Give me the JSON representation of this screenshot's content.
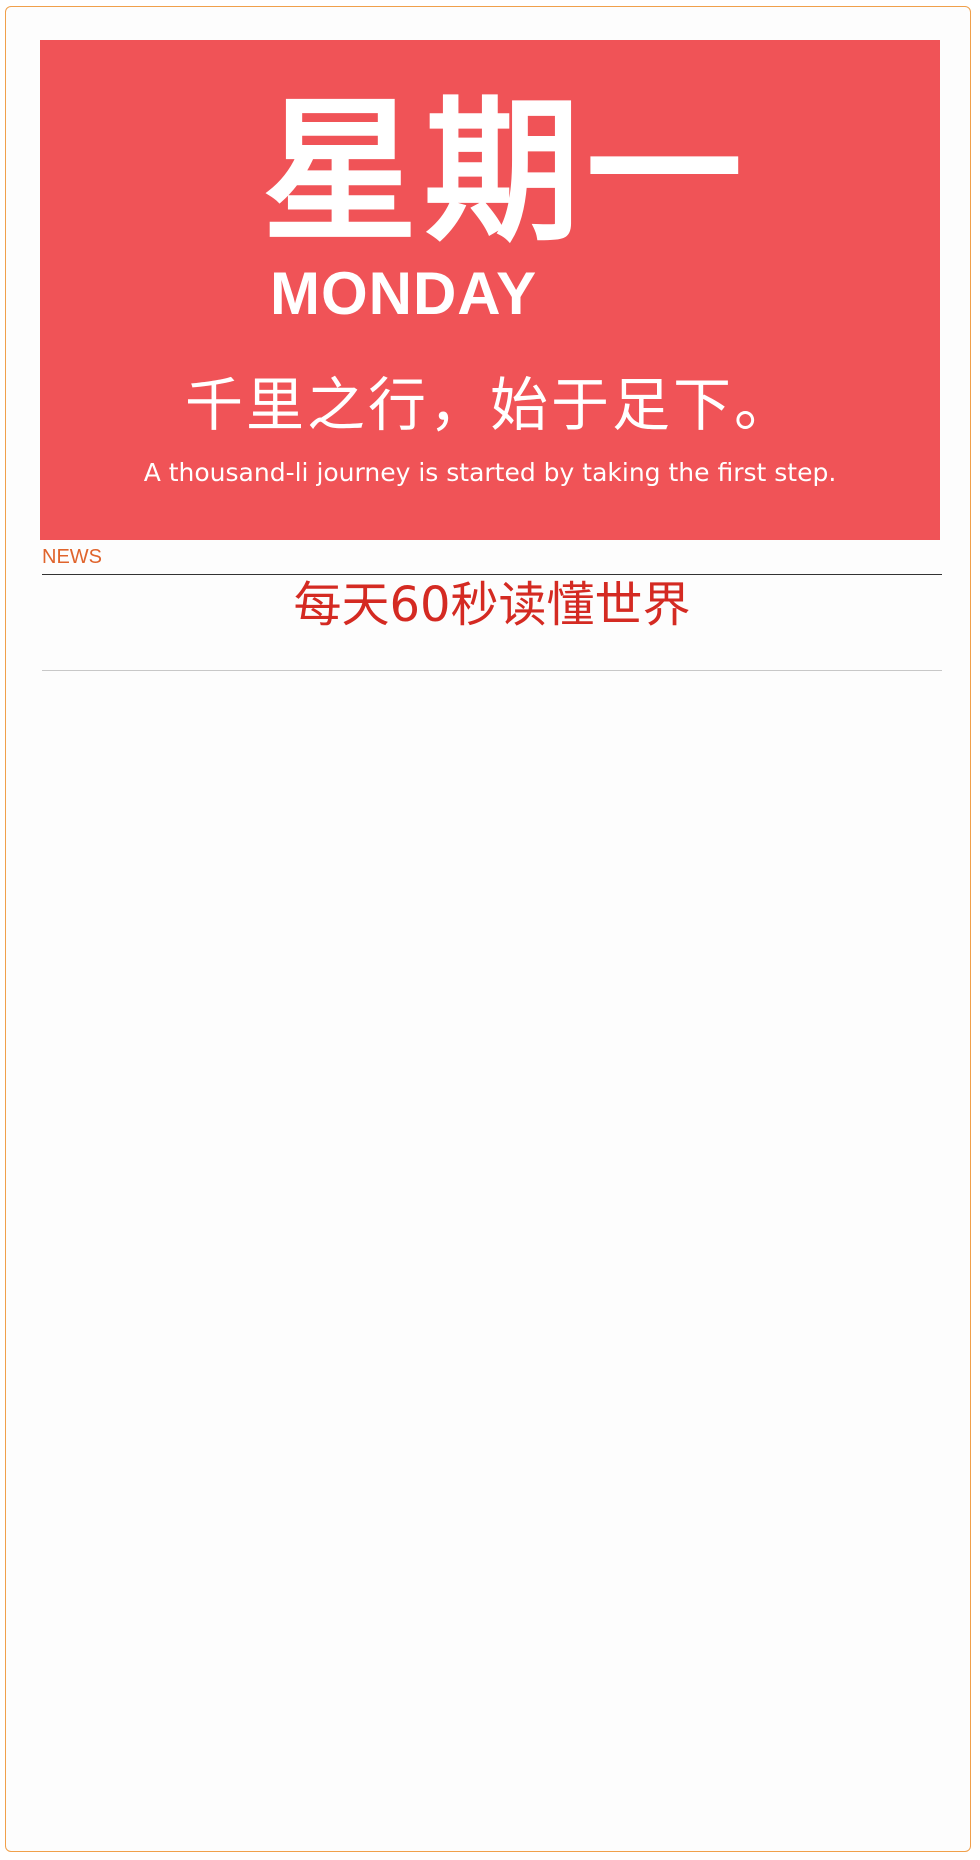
{
  "banner": {
    "weekday_cn": "星期一",
    "weekday_en": "MONDAY",
    "proverb_cn": "千里之行，始于足下。",
    "proverb_en": "A thousand-li journey is started by taking the first step.",
    "background_color": "#f05357",
    "text_color": "#ffffff"
  },
  "section": {
    "label": "NEWS",
    "label_color": "#e0642c"
  },
  "headline": {
    "text": "每天60秒读懂世界",
    "color": "#d42a22"
  },
  "frame": {
    "border_color": "#f0a04b"
  }
}
